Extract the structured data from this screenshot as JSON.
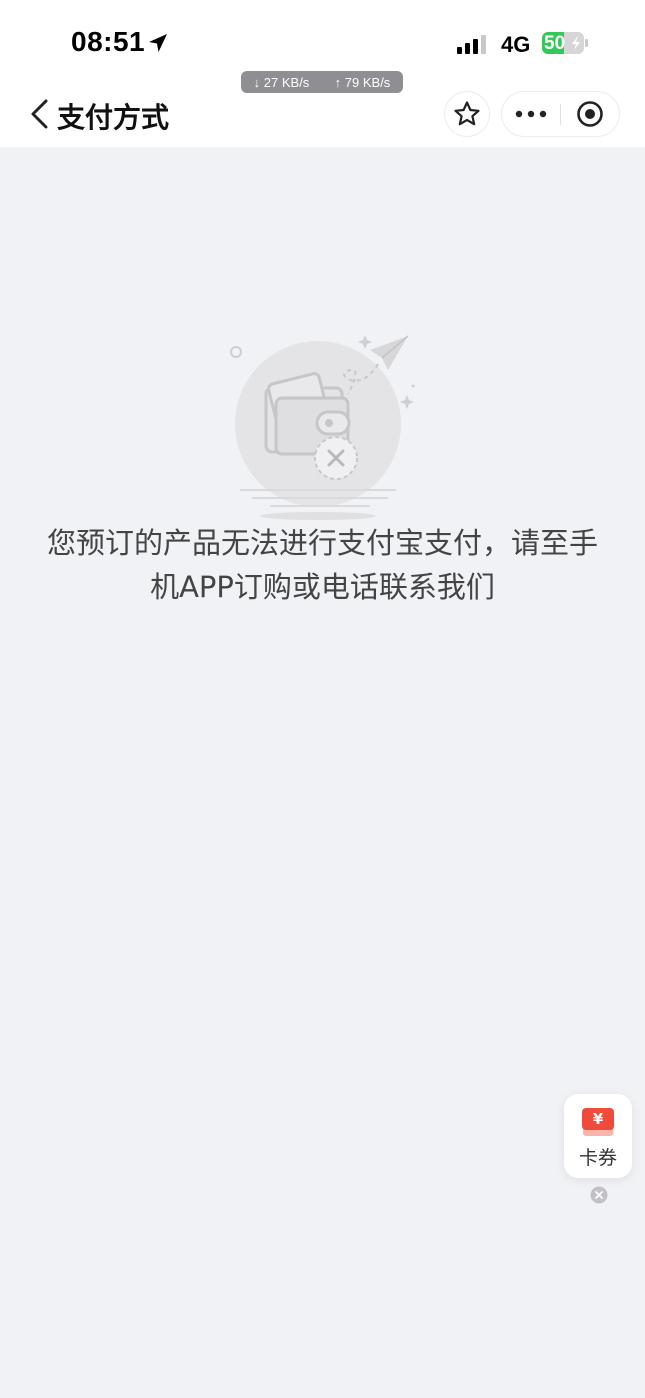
{
  "status_bar": {
    "time": "08:51",
    "network": "4G",
    "battery": "50",
    "speed_down": "↓ 27 KB/s",
    "speed_up": "↑ 79 KB/s"
  },
  "nav": {
    "title": "支付方式"
  },
  "message": "您预订的产品无法进行支付宝支付，请至手机APP订购或电话联系我们",
  "coupon": {
    "label": "卡券",
    "symbol": "¥"
  },
  "colors": {
    "background": "#f1f2f6",
    "battery_green": "#34c759",
    "coupon_red": "#f04a3a"
  }
}
